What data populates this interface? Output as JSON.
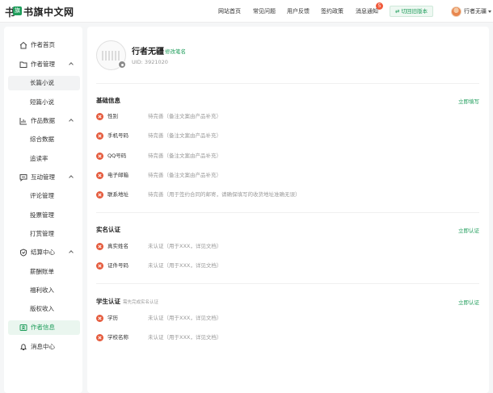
{
  "header": {
    "logo_mark": "书",
    "logo_badge": "旗",
    "logo_text": "书旗中文网",
    "nav": [
      "网站首页",
      "常见问题",
      "用户反馈",
      "签约政策",
      "消息通知"
    ],
    "notification_count": "5",
    "switch_label": "⇄ 切回旧版本",
    "user_name": "行者无疆"
  },
  "sidebar": {
    "items": [
      {
        "label": "作者首页",
        "type": "parent",
        "icon": "home-icon"
      },
      {
        "label": "作者管理",
        "type": "parent",
        "icon": "folder-icon",
        "expanded": true
      },
      {
        "label": "长篇小说",
        "type": "child",
        "selected": true
      },
      {
        "label": "短篇小说",
        "type": "child"
      },
      {
        "label": "作品数据",
        "type": "parent",
        "icon": "chart-icon",
        "expanded": true
      },
      {
        "label": "综合数据",
        "type": "child"
      },
      {
        "label": "追读率",
        "type": "child"
      },
      {
        "label": "互动管理",
        "type": "parent",
        "icon": "message-icon",
        "expanded": true
      },
      {
        "label": "评论管理",
        "type": "child"
      },
      {
        "label": "投票管理",
        "type": "child"
      },
      {
        "label": "打赏管理",
        "type": "child"
      },
      {
        "label": "结算中心",
        "type": "parent",
        "icon": "settlement-icon",
        "expanded": true
      },
      {
        "label": "薪酬账单",
        "type": "child"
      },
      {
        "label": "福利收入",
        "type": "child"
      },
      {
        "label": "版权收入",
        "type": "child"
      },
      {
        "label": "作者信息",
        "type": "parent",
        "icon": "profile-card-icon",
        "active": true
      },
      {
        "label": "消息中心",
        "type": "parent",
        "icon": "bell-icon"
      }
    ]
  },
  "profile": {
    "name": "行者无疆",
    "edit_label": "修改笔名",
    "uid": "UID: 3921020"
  },
  "sections": {
    "basic": {
      "title": "基础信息",
      "action": "立即填写",
      "rows": [
        {
          "label": "性别",
          "value": "待完善（备注文案由产品补充）"
        },
        {
          "label": "手机号码",
          "value": "待完善（备注文案由产品补充）"
        },
        {
          "label": "QQ号码",
          "value": "待完善（备注文案由产品补充）"
        },
        {
          "label": "电子邮箱",
          "value": "待完善（备注文案由产品补充）"
        },
        {
          "label": "联系地址",
          "value": "待完善（用于签约合同的邮寄，请确保填写的收货地址准确无误）"
        }
      ]
    },
    "realname": {
      "title": "实名认证",
      "action": "立即认证",
      "rows": [
        {
          "label": "真实姓名",
          "value": "未认证（用于XXX，详见文档）"
        },
        {
          "label": "证件号码",
          "value": "未认证（用于XXX，详见文档）"
        }
      ]
    },
    "student": {
      "title": "学生认证",
      "note": "需先完成实名认证",
      "action": "立即认证",
      "rows": [
        {
          "label": "学历",
          "value": "未认证（用于XXX，详见文档）"
        },
        {
          "label": "学校名称",
          "value": "未认证（用于XXX，详见文档）"
        }
      ]
    }
  },
  "colors": {
    "accent": "#1f9d5b",
    "error": "#e55a3c",
    "notification": "#f05a3c"
  }
}
